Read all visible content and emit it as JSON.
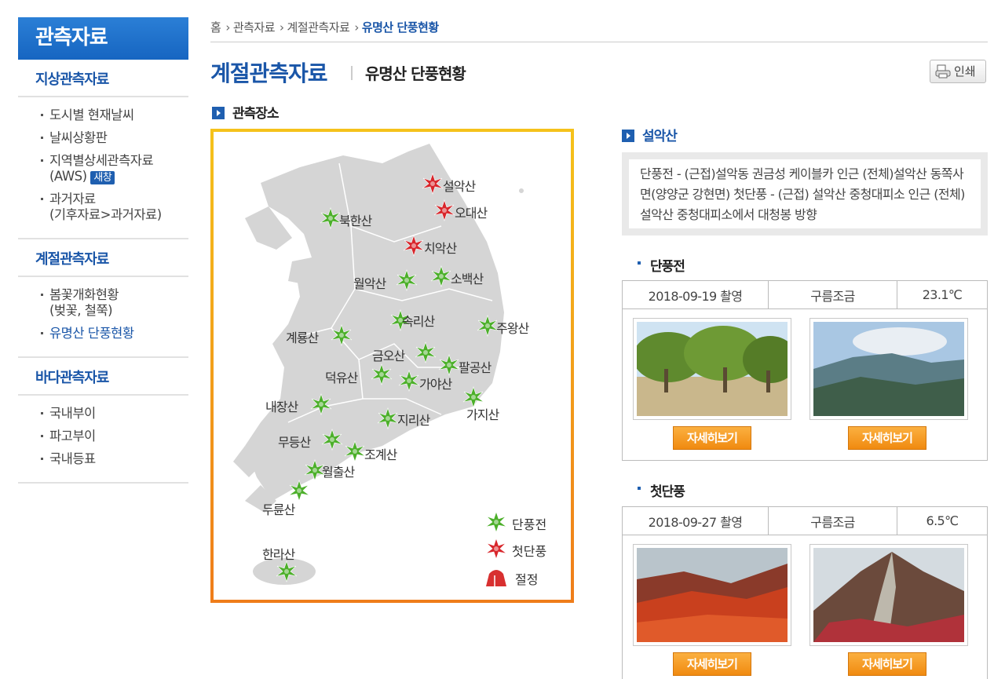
{
  "sidebar": {
    "title": "관측자료",
    "groups": [
      {
        "label": "지상관측자료",
        "items": [
          "도시별 현재날씨",
          "날씨상황판",
          "지역별상세관측자료",
          "(AWS)",
          "새창",
          "과거자료",
          "(기후자료>과거자료)"
        ]
      },
      {
        "label": "계절관측자료",
        "items": [
          "봄꽃개화현황",
          "(벚꽃, 철쭉)",
          "유명산 단풍현황"
        ]
      },
      {
        "label": "바다관측자료",
        "items": [
          "국내부이",
          "파고부이",
          "국내등표"
        ]
      }
    ]
  },
  "breadcrumb": [
    "홈",
    "관측자료",
    "계절관측자료",
    "유명산 단풍현황"
  ],
  "page": {
    "title": "계절관측자료",
    "subtitle": "유명산 단풍현황",
    "print": "인쇄",
    "obs_label": "관측장소"
  },
  "map": {
    "mountains": [
      "설악산",
      "오대산",
      "북한산",
      "치악산",
      "월악산",
      "소백산",
      "속리산",
      "주왕산",
      "계룡산",
      "금오산",
      "팔공산",
      "덕유산",
      "가야산",
      "내장산",
      "가지산",
      "지리산",
      "무등산",
      "조계산",
      "월출산",
      "두륜산",
      "한라산"
    ],
    "legend": [
      "단풍전",
      "첫단풍",
      "절정"
    ],
    "colors": {
      "green": "#4caf2a",
      "red": "#d8262b",
      "peak": "#d83030"
    }
  },
  "detail": {
    "mountain": "설악산",
    "desc": "단풍전 - (근접)설악동 권금성 케이블카 인근 (전체)설악산 동쪽사면(양양군 강현면) 첫단풍 - (근접) 설악산 중청대피소 인근 (전체) 설악산 중청대피소에서 대청봉 방향",
    "sections": [
      {
        "label": "단풍전",
        "date": "2018-09-19 촬영",
        "weather": "구름조금",
        "temp": "23.1℃",
        "button": "자세히보기"
      },
      {
        "label": "첫단풍",
        "date": "2018-09-27 촬영",
        "weather": "구름조금",
        "temp": "6.5℃",
        "button": "자세히보기"
      }
    ]
  }
}
